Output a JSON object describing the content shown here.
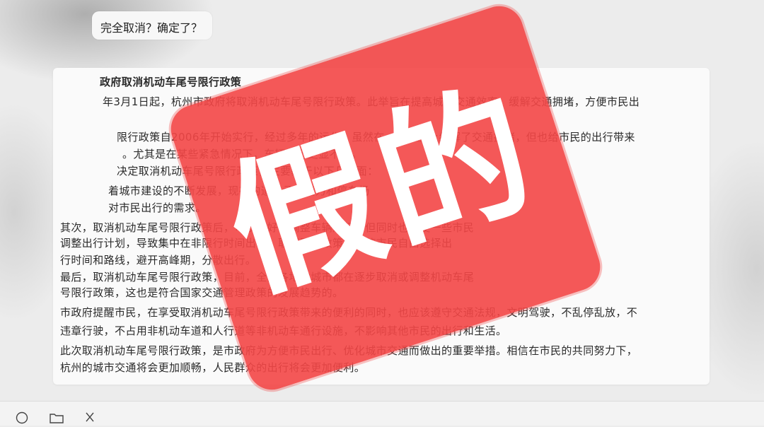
{
  "user_message": "完全取消？确定了？",
  "article": {
    "lines": [
      "政府取消机动车尾号限行政策",
      "年3月1日起，杭州市政府将取消机动车尾号限行政策。此举旨在提高城市交通效率，缓解交通拥堵，方便市民出",
      "",
      "限行政策自2006年开始实行，经过多年的运作，虽然在一定程度上缓解了交通拥堵，但也给市民的出行带来",
      "。尤其是在某些紧急情况下，车辆限行更显不便。",
      "决定取消机动车尾号限行政策，主要基于以下几方面：",
      "着城市建设的不断发展，现有的道路承载能力和停车场",
      "对市民出行的需求。",
      "其次，取消机动车尾号限行政策后，可以更好地调整车辆通行，但同时也会使一些市民",
      "调整出行计划，导致集中在非限行时间出行，取消限行政策可以使市民自由选择出",
      "行时间和路线，避开高峰期，分散出行。",
      "最后，取消机动车尾号限行政策，目前，全国各地的城市都在逐步取消或调整机动车尾",
      "号限行政策，这也是符合国家交通管理政策的发展趋势的。",
      "市政府提醒市民，在享受取消机动车尾号限行政策带来的便利的同时，也应该遵守交通法规，文明驾驶，不乱停乱放，不",
      "违章行驶，不占用非机动车道和人行道等非机动车通行设施，不影响其他市民的出行和生活。",
      "此次取消机动车尾号限行政策，是市政府为方便市民出行、优化城市交通而做出的重要举措。相信在市民的共同努力下，",
      "杭州的城市交通将会更加顺畅，人民群众的出行将会更加便利。"
    ]
  },
  "stamp": {
    "text": "假的",
    "color": "#f34646"
  },
  "toolbar": {
    "icons": [
      "smile-icon",
      "folder-icon",
      "scissors-icon"
    ]
  }
}
